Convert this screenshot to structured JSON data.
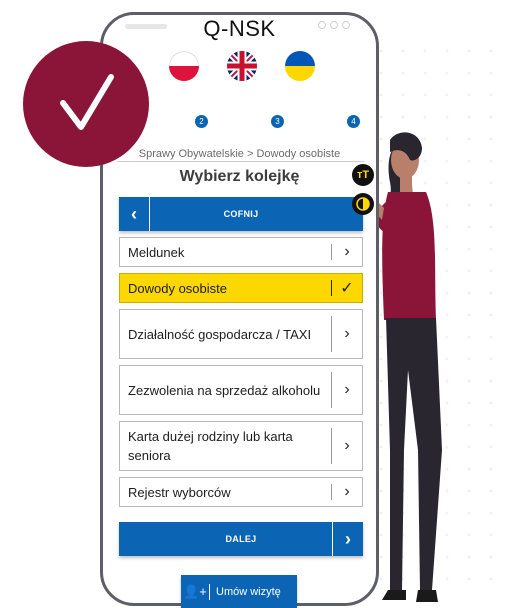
{
  "app": {
    "title": "Q-NSK"
  },
  "flags": [
    {
      "name": "flag-pl-icon"
    },
    {
      "name": "flag-gb-icon"
    },
    {
      "name": "flag-ua-icon"
    }
  ],
  "steps": [
    "2",
    "3",
    "4"
  ],
  "breadcrumb": "Sprawy Obywatelskie > Dowody osobiste",
  "page_title": "Wybierz kolejkę",
  "back_button": {
    "label": "COFNIJ",
    "icon": "chevron-left-icon"
  },
  "next_button": {
    "label": "DALEJ",
    "icon": "chevron-right-icon"
  },
  "queues": [
    {
      "label": "Meldunek",
      "selected": false
    },
    {
      "label": "Dowody osobiste",
      "selected": true
    },
    {
      "label": "Działalność gospodarcza / TAXI",
      "selected": false
    },
    {
      "label": "Zezwolenia na sprzedaż alkoholu",
      "selected": false
    },
    {
      "label": "Karta dużej rodziny lub karta seniora",
      "selected": false
    },
    {
      "label": "Rejestr wyborców",
      "selected": false
    }
  ],
  "appointment_button": {
    "label": "Umów wizytę",
    "icon": "add-user-icon"
  },
  "accessibility": {
    "text_size_icon": "text-size-icon",
    "contrast_icon": "contrast-icon"
  },
  "colors": {
    "primary": "#0b64b4",
    "selected": "#fcd800",
    "badge": "#8a1538"
  }
}
